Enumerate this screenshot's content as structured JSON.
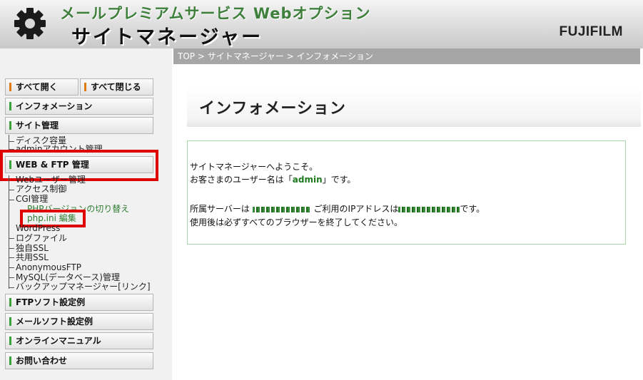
{
  "header": {
    "title_top": "メールプレミアムサービス Webオプション",
    "title_main": "サイトマネージャー",
    "brand": "FUJIFILM"
  },
  "breadcrumb": "TOP > サイトマネージャー > インフォメーション",
  "sidebar": {
    "open_all": "すべて開く",
    "close_all": "すべて閉じる",
    "information": "インフォメーション",
    "site_admin": "サイト管理",
    "site_items": [
      "ディスク容量",
      "adminアカウント管理"
    ],
    "web_ftp": "WEB & FTP 管理",
    "web_items": [
      "Webユーザー管理",
      "アクセス制御",
      "CGI管理"
    ],
    "cgi_sub": [
      "PHPバージョンの切り替え",
      "php.ini 編集"
    ],
    "web_items2": [
      "WordPress",
      "ログファイル",
      "独自SSL",
      "共用SSL",
      "AnonymousFTP",
      "MySQL(データベース)管理",
      "バックアップマネージャー[リンク]"
    ],
    "ftp_soft": "FTPソフト設定例",
    "mail_soft": "メールソフト設定例",
    "online_manual": "オンラインマニュアル",
    "contact": "お問い合わせ"
  },
  "main": {
    "heading": "インフォメーション",
    "welcome": "サイトマネージャーへようこそ。",
    "user_prefix": "お客さまのユーザー名は「",
    "user_name": "admin",
    "user_suffix": "」です。",
    "server_prefix": "所属サーバーは",
    "server_mid": "ご利用のIPアドレスは",
    "server_suffix": "です。",
    "logout_note": "使用後は必ずすべてのブラウザーを終了してください。"
  },
  "colors": {
    "accent_green": "#3aa13a",
    "highlight_red": "#e00000",
    "breadcrumb_bg": "#a6a6a6"
  }
}
